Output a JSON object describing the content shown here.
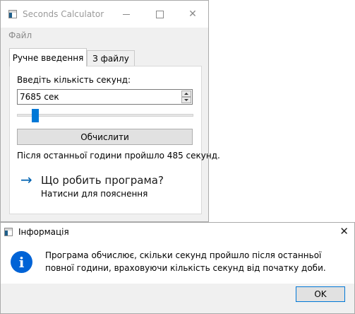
{
  "main_window": {
    "title": "Seconds Calculator",
    "menu": {
      "file": "Файл"
    },
    "tabs": [
      {
        "label": "Ручне введення",
        "active": true
      },
      {
        "label": "З файлу",
        "active": false
      }
    ],
    "seconds_label": "Введіть кількість секунд:",
    "seconds_value": "7685 сек",
    "slider": {
      "value": 7685,
      "min": 0,
      "max": 86399
    },
    "calculate_label": "Обчислити",
    "result_text": "Після останньої години пройшло 485 секунд.",
    "help": {
      "title": "Що робить програма?",
      "subtitle": "Натисни для пояснення"
    }
  },
  "dialog": {
    "title": "Інформація",
    "message": "Програма обчислює, скільки секунд пройшло після останньої повної години, враховуючи кількість секунд від початку доби.",
    "ok_label": "OK"
  },
  "colors": {
    "accent": "#0078d7",
    "info_icon": "#0063d6",
    "window_bg": "#f0f0f0"
  }
}
